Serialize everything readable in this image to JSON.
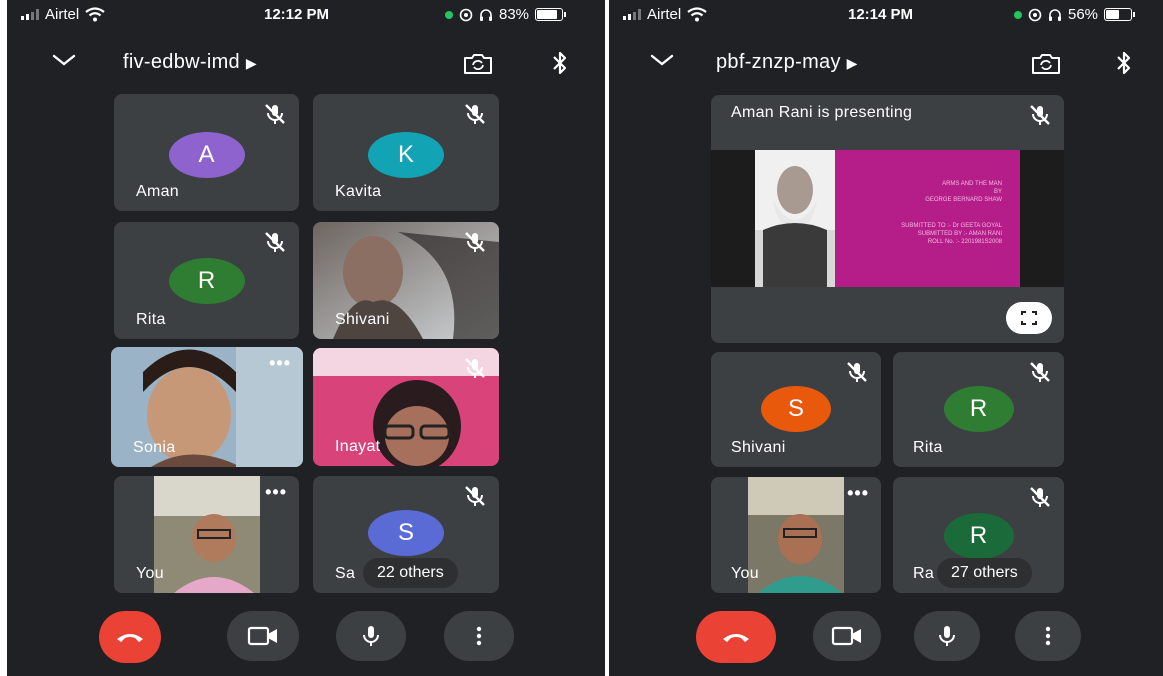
{
  "status_left": {
    "carrier": "Airtel",
    "time": "12:12 PM",
    "battery": "83%",
    "battery_level": 0.83
  },
  "status_right": {
    "carrier": "Airtel",
    "time": "12:14 PM",
    "battery": "56%",
    "battery_level": 0.56
  },
  "screen1": {
    "meeting_code": "fiv-edbw-imd",
    "participants": [
      {
        "name": "Aman",
        "initial": "A",
        "color": "#8e63ce",
        "muted": true
      },
      {
        "name": "Kavita",
        "initial": "K",
        "color": "#12a4b4",
        "muted": true
      },
      {
        "name": "Rita",
        "initial": "R",
        "color": "#2e7d32",
        "muted": true
      },
      {
        "name": "Shivani",
        "video": true,
        "muted": true
      },
      {
        "name": "Sonia",
        "video": true,
        "selected": true
      },
      {
        "name": "Inayat",
        "video": true,
        "muted": true
      },
      {
        "name": "You",
        "video": true
      },
      {
        "name": "Sa",
        "initial": "S",
        "color": "#5b6bd5",
        "muted": true
      }
    ],
    "others": "22 others"
  },
  "screen2": {
    "meeting_code": "pbf-znzp-may",
    "presenting": "Aman Rani is presenting",
    "slide": {
      "title": "ARMS AND THE MAN",
      "by": "BY",
      "author": "GEORGE BERNARD SHAW",
      "submitted_to": "SUBMITTED TO :- Dr GEETA GOYAL",
      "submitted_by": "SUBMITTED BY :- AMAN RANI",
      "roll": "ROLL No. :- 2201981S2008"
    },
    "participants": [
      {
        "name": "Shivani",
        "initial": "S",
        "color": "#e8590c",
        "muted": true
      },
      {
        "name": "Rita",
        "initial": "R",
        "color": "#2e7d32",
        "muted": true
      },
      {
        "name": "You",
        "video": true
      },
      {
        "name": "Ra",
        "initial": "R",
        "color": "#1b6b3a",
        "muted": true
      }
    ],
    "others": "27 others"
  },
  "icons": {
    "chevron": "chevron-down-icon",
    "switch_camera": "switch-camera-icon",
    "bluetooth": "bluetooth-icon",
    "mic_off": "mic-off-icon",
    "end_call": "end-call-icon",
    "video": "video-icon",
    "mic": "mic-icon",
    "more": "more-vert-icon",
    "fullscreen": "fullscreen-icon"
  },
  "colors": {
    "background": "#202124",
    "tile": "#3c4043",
    "end_call": "#ea4335",
    "selected_outline": "#8ab4f8"
  }
}
